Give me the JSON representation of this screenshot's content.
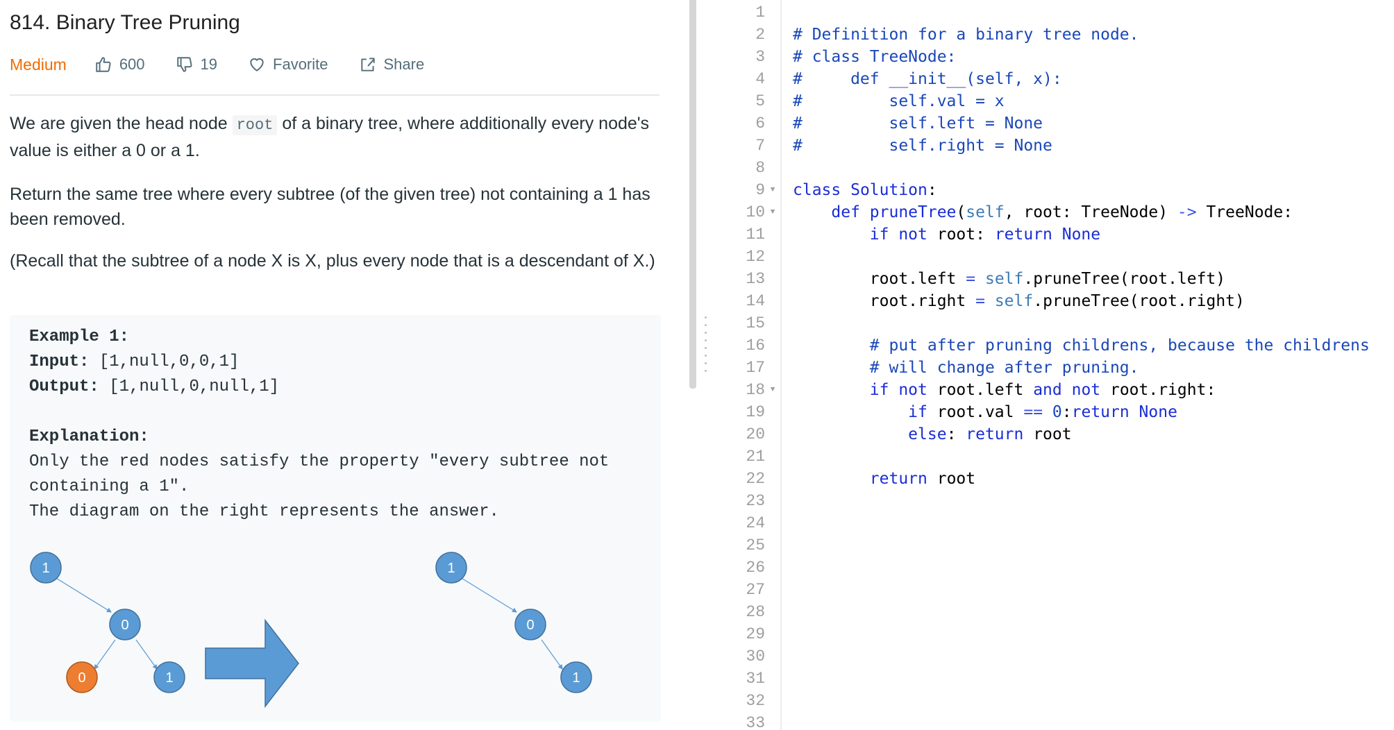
{
  "problem": {
    "title": "814. Binary Tree Pruning",
    "difficulty": "Medium",
    "likes": "600",
    "dislikes": "19",
    "favorite_label": "Favorite",
    "share_label": "Share",
    "desc_1_before": "We are given the head node ",
    "desc_1_code": "root",
    "desc_1_after": " of a binary tree, where additionally every node's value is either a 0 or a 1.",
    "desc_2": "Return the same tree where every subtree (of the given tree) not containing a 1 has been removed.",
    "desc_3": "(Recall that the subtree of a node X is X, plus every node that is a descendant of X.)",
    "example": {
      "heading": "Example 1:",
      "input_label": "Input:",
      "input_value": " [1,null,0,0,1]",
      "output_label": "Output:",
      "output_value": " [1,null,0,null,1]",
      "explanation_label": "Explanation:",
      "explanation_lines": [
        "Only the red nodes satisfy the property \"every subtree not",
        "containing a 1\".",
        "The diagram on the right represents the answer."
      ]
    },
    "diagram": {
      "before_nodes": [
        "1",
        "0",
        "0",
        "1"
      ],
      "after_nodes": [
        "1",
        "0",
        "1"
      ],
      "colors": {
        "blue": "#5b9bd5",
        "orange": "#ed7d31",
        "arrow": "#5b9bd5"
      }
    }
  },
  "editor": {
    "line_numbers": [
      "1",
      "2",
      "3",
      "4",
      "5",
      "6",
      "7",
      "8",
      "9",
      "10",
      "11",
      "12",
      "13",
      "14",
      "15",
      "16",
      "17",
      "18",
      "19",
      "20",
      "21",
      "22",
      "23",
      "24",
      "25",
      "26",
      "27",
      "28",
      "29",
      "30",
      "31",
      "32",
      "33"
    ],
    "fold_lines": [
      "9",
      "10",
      "18"
    ],
    "code_lines": [
      [],
      [
        [
          "comment",
          "# Definition for a binary tree node."
        ]
      ],
      [
        [
          "comment",
          "# class TreeNode:"
        ]
      ],
      [
        [
          "comment",
          "#     def __init__(self, x):"
        ]
      ],
      [
        [
          "comment",
          "#         self.val = x"
        ]
      ],
      [
        [
          "comment",
          "#         self.left = None"
        ]
      ],
      [
        [
          "comment",
          "#         self.right = None"
        ]
      ],
      [],
      [
        [
          "kw",
          "class "
        ],
        [
          "kw",
          "Solution"
        ],
        [
          "plain",
          ":"
        ]
      ],
      [
        [
          "plain",
          "    "
        ],
        [
          "kw",
          "def "
        ],
        [
          "kw",
          "pruneTree"
        ],
        [
          "plain",
          "("
        ],
        [
          "self",
          "self"
        ],
        [
          "plain",
          ", root: TreeNode) "
        ],
        [
          "op",
          "->"
        ],
        [
          "plain",
          " TreeNode:"
        ]
      ],
      [
        [
          "plain",
          "        "
        ],
        [
          "kw",
          "if not "
        ],
        [
          "plain",
          "root: "
        ],
        [
          "kw",
          "return None"
        ]
      ],
      [],
      [
        [
          "plain",
          "        root.left "
        ],
        [
          "op",
          "="
        ],
        [
          "plain",
          " "
        ],
        [
          "self",
          "self"
        ],
        [
          "plain",
          ".pruneTree(root.left)"
        ]
      ],
      [
        [
          "plain",
          "        root.right "
        ],
        [
          "op",
          "="
        ],
        [
          "plain",
          " "
        ],
        [
          "self",
          "self"
        ],
        [
          "plain",
          ".pruneTree(root.right)"
        ]
      ],
      [],
      [
        [
          "plain",
          "        "
        ],
        [
          "comment",
          "# put after pruning childrens, because the childrens"
        ]
      ],
      [
        [
          "plain",
          "        "
        ],
        [
          "comment",
          "# will change after pruning."
        ]
      ],
      [
        [
          "plain",
          "        "
        ],
        [
          "kw",
          "if not "
        ],
        [
          "plain",
          "root.left "
        ],
        [
          "kw",
          "and not "
        ],
        [
          "plain",
          "root.right:"
        ]
      ],
      [
        [
          "plain",
          "            "
        ],
        [
          "kw",
          "if "
        ],
        [
          "plain",
          "root.val "
        ],
        [
          "op",
          "=="
        ],
        [
          "plain",
          " "
        ],
        [
          "num",
          "0"
        ],
        [
          "plain",
          ":"
        ],
        [
          "kw",
          "return None"
        ]
      ],
      [
        [
          "plain",
          "            "
        ],
        [
          "kw",
          "else"
        ],
        [
          "plain",
          ": "
        ],
        [
          "kw",
          "return "
        ],
        [
          "plain",
          "root"
        ]
      ],
      [],
      [
        [
          "plain",
          "        "
        ],
        [
          "kw",
          "return "
        ],
        [
          "plain",
          "root"
        ]
      ],
      [],
      [],
      [],
      [],
      [],
      [],
      [],
      [],
      [],
      [],
      []
    ]
  }
}
